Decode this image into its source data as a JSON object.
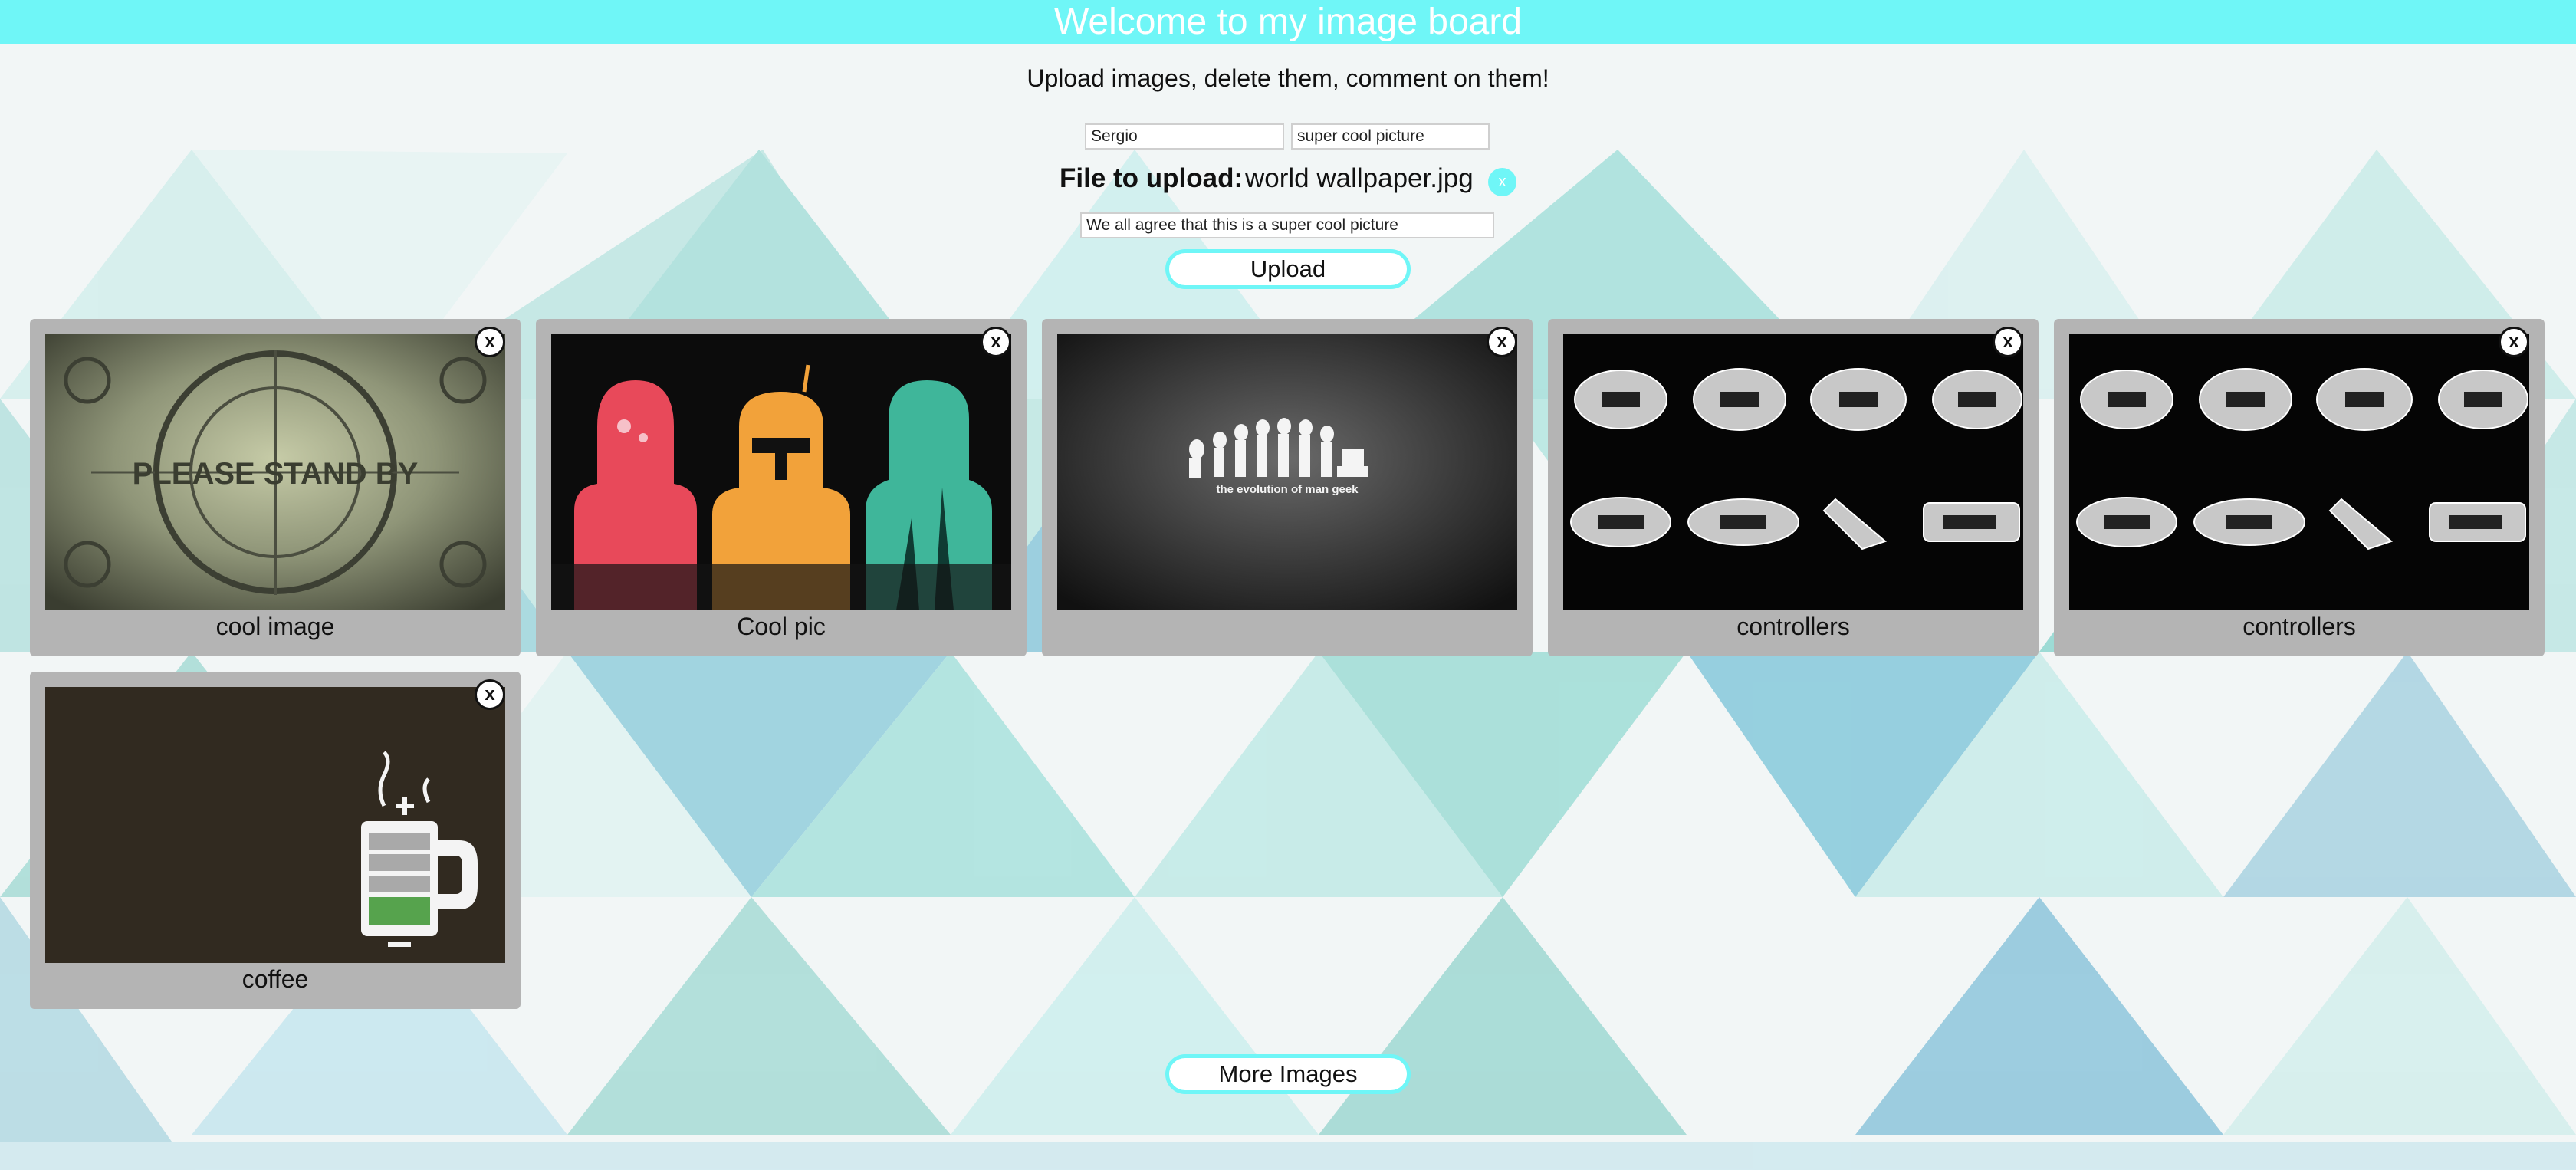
{
  "header": {
    "title": "Welcome to my image board"
  },
  "subtitle": "Upload images, delete them, comment on them!",
  "form": {
    "username": "Sergio",
    "title": "super cool picture",
    "file_label": "File to upload:",
    "file_name": "world wallpaper.jpg",
    "clear_label": "x",
    "description": "We all agree that this is a super cool picture",
    "upload_label": "Upload"
  },
  "cards": [
    {
      "caption": "cool image",
      "image": "please-stand-by-test-pattern",
      "image_text": "PLEASE STAND BY",
      "delete_label": "x"
    },
    {
      "caption": "Cool pic",
      "image": "star-wars-silhouettes",
      "delete_label": "x"
    },
    {
      "caption": "",
      "image": "evolution-of-man-geek",
      "image_text": "the evolution of man geek",
      "delete_label": "x"
    },
    {
      "caption": "controllers",
      "image": "game-controllers-xray",
      "delete_label": "x"
    },
    {
      "caption": "controllers",
      "image": "game-controllers-xray",
      "delete_label": "x"
    },
    {
      "caption": "coffee",
      "image": "coffee-battery-mug",
      "delete_label": "x"
    }
  ],
  "more_images_label": "More Images",
  "colors": {
    "accent": "#6ff6f7",
    "card": "#b4b4b4",
    "triangle_a": "#a9e3de",
    "triangle_b": "#9cc9dd"
  }
}
